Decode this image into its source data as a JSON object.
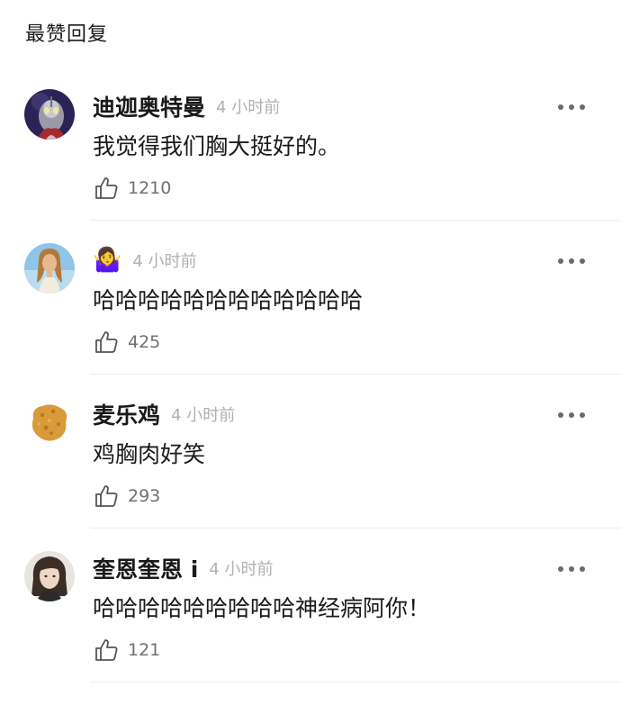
{
  "section": {
    "title": "最赞回复"
  },
  "comments": [
    {
      "username": "迪迦奥特曼",
      "time": "4 小时前",
      "text": "我觉得我们胸大挺好的。",
      "likes": "1210",
      "avatar_icon": "ultraman-avatar"
    },
    {
      "username": "🤷‍♀️",
      "time": "4 小时前",
      "text": "哈哈哈哈哈哈哈哈哈哈哈哈",
      "likes": "425",
      "avatar_icon": "girl-avatar"
    },
    {
      "username": "麦乐鸡",
      "time": "4 小时前",
      "text": "鸡胸肉好笑",
      "likes": "293",
      "avatar_icon": "chicken-nugget-avatar"
    },
    {
      "username": "奎恩奎恩 i",
      "time": "4 小时前",
      "text": "哈哈哈哈哈哈哈哈哈神经病阿你！",
      "likes": "121",
      "avatar_icon": "person-avatar"
    }
  ],
  "colors": {
    "text": "#1a1a1a",
    "meta": "#b0b0b0",
    "like_count": "#707070",
    "divider": "#ececec"
  }
}
